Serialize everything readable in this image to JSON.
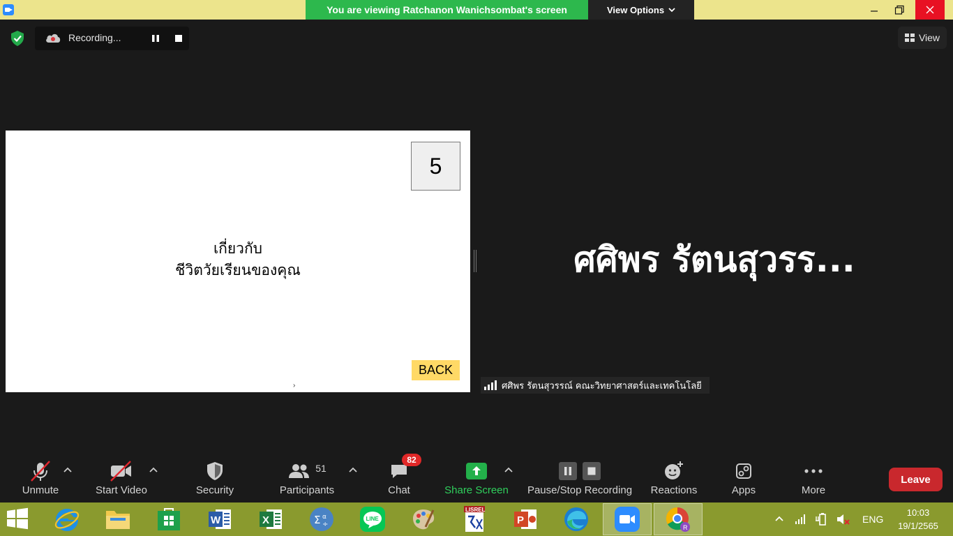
{
  "titlebar": {
    "banner": "You are viewing Ratchanon Wanichsombat's screen",
    "view_options": "View Options",
    "minimize": "—",
    "maximize": "❐",
    "close": "✕"
  },
  "meeting_top": {
    "recording_label": "Recording...",
    "view_label": "View"
  },
  "slide": {
    "page_number": "5",
    "line1": "เกี่ยวกับ",
    "line2": "ชีวิตวัยเรียนของคุณ",
    "back_label": "BACK",
    "cursor": "›"
  },
  "participant": {
    "big_name": "ศศิพร รัตนสุวรร...",
    "name_tag": "ศศิพร รัตนสุวรรณ์ คณะวิทยาศาสตร์และเทคโนโลยี"
  },
  "toolbar": {
    "unmute": "Unmute",
    "start_video": "Start Video",
    "security": "Security",
    "participants": "Participants",
    "participants_count": "51",
    "chat": "Chat",
    "chat_badge": "82",
    "share_screen": "Share Screen",
    "pause_stop_recording": "Pause/Stop Recording",
    "reactions": "Reactions",
    "apps": "Apps",
    "more": "More",
    "leave": "Leave"
  },
  "taskbar": {
    "apps": [
      "internet-explorer",
      "file-explorer",
      "store",
      "word",
      "excel",
      "math-input",
      "line",
      "paint",
      "lisrel",
      "powerpoint",
      "edge",
      "zoom",
      "chrome"
    ],
    "lang": "ENG",
    "time": "10:03",
    "date": "19/1/2565"
  },
  "colors": {
    "banner_green": "#2db84d",
    "titlebar_yellow": "#ece48c",
    "share_green": "#2db84d",
    "leave_red": "#c9282d",
    "taskbar": "#8a9a2e"
  }
}
